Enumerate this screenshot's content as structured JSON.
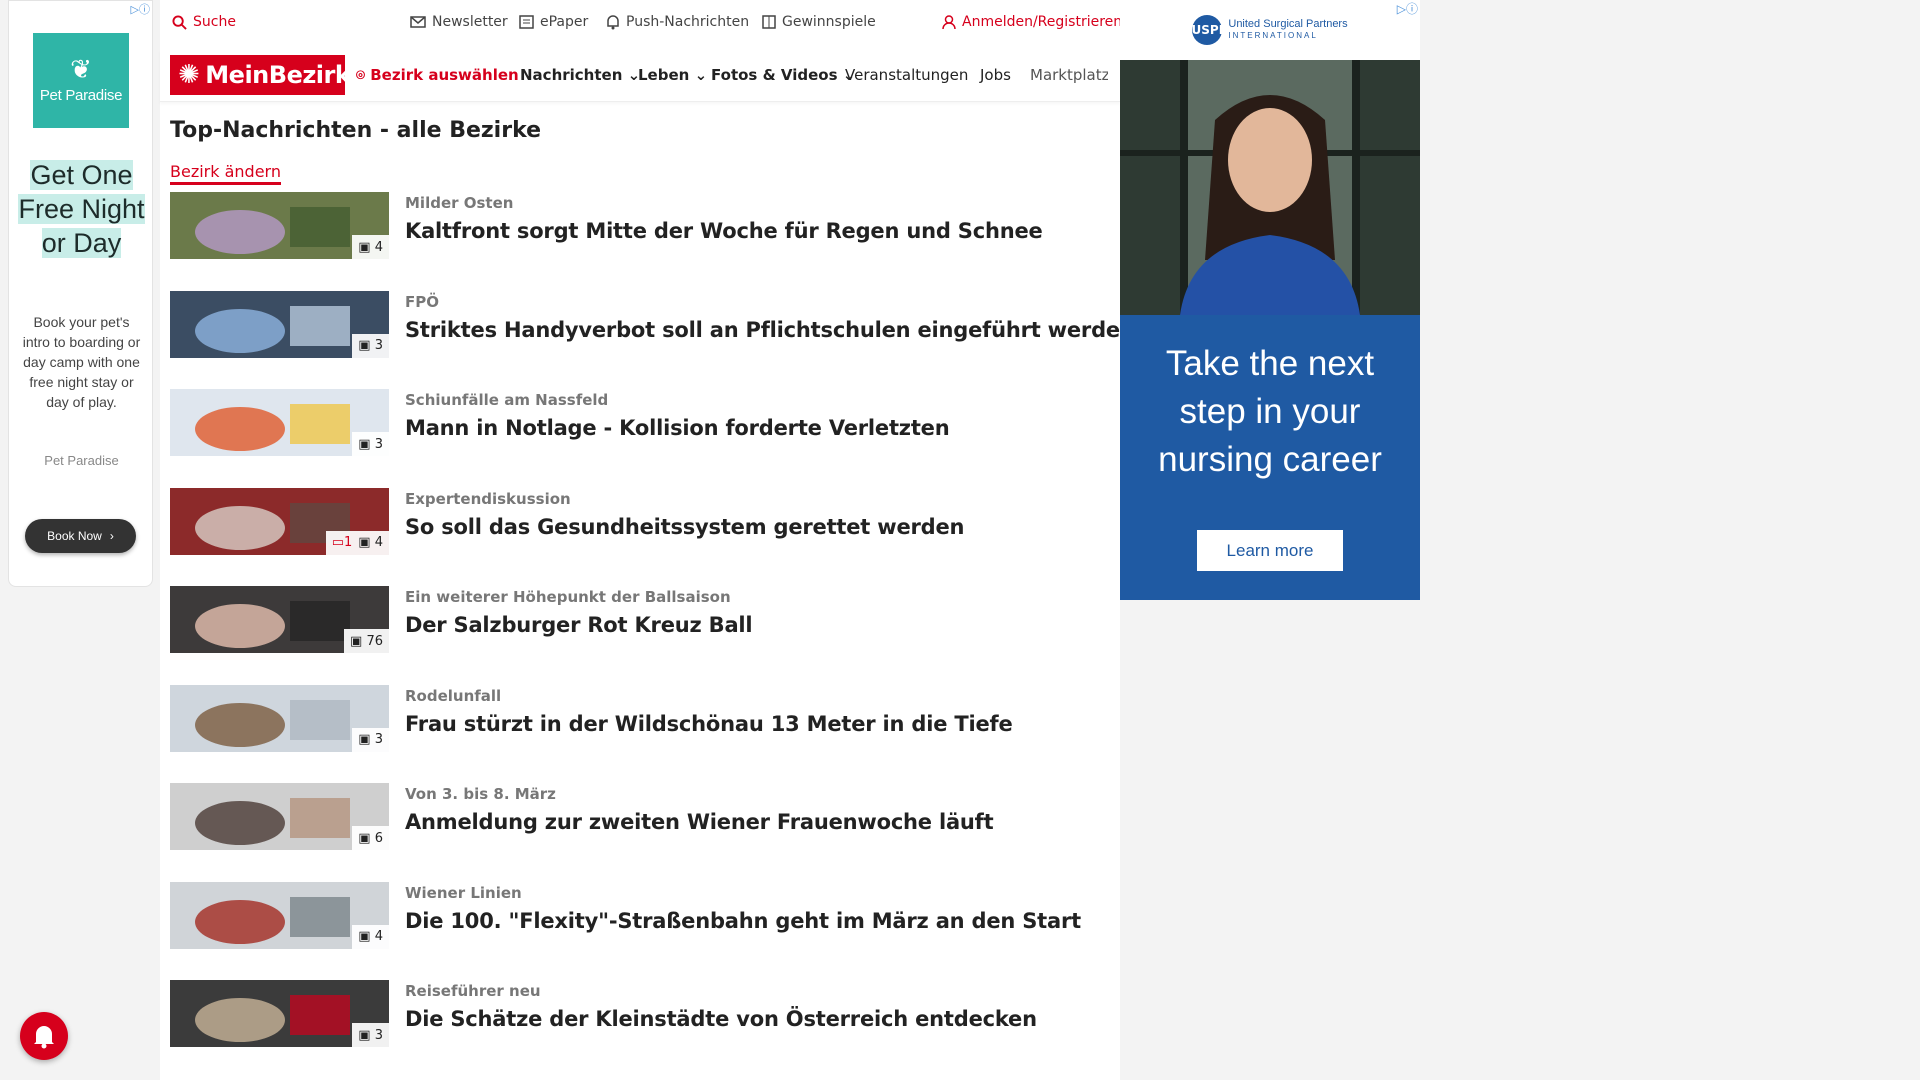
{
  "left_ad": {
    "brand": "Pet Paradise",
    "headline": "Get One Free Night or Day",
    "body": "Book your pet's intro to boarding or day camp with one free night stay or day of play.",
    "advertiser": "Pet Paradise",
    "cta": "Book Now"
  },
  "topbar": {
    "search": "Suche",
    "newsletter": "Newsletter",
    "epaper": "ePaper",
    "push": "Push-Nachrichten",
    "games": "Gewinnspiele",
    "login": "Anmelden/Registrieren"
  },
  "nav": {
    "logo": "MeinBezirk",
    "district": "Bezirk auswählen",
    "items": [
      "Nachrichten",
      "Leben",
      "Fotos & Videos",
      "Veranstaltungen",
      "Jobs",
      "Marktplatz"
    ]
  },
  "page": {
    "title": "Top-Nachrichten - alle Bezirke",
    "change_district": "Bezirk ändern"
  },
  "articles": [
    {
      "category": "Milder Osten",
      "title": "Kaltfront sorgt Mitte der Woche für Regen und Schnee",
      "images": "4",
      "comments": ""
    },
    {
      "category": "FPÖ",
      "title": "Striktes Handyverbot soll an Pflichtschulen eingeführt werden",
      "images": "3",
      "comments": ""
    },
    {
      "category": "Schiunfälle am Nassfeld",
      "title": "Mann in Notlage - Kollision forderte Verletzten",
      "images": "3",
      "comments": ""
    },
    {
      "category": "Expertendiskussion",
      "title": "So soll das Gesundheitssystem gerettet werden",
      "images": "4",
      "comments": "1"
    },
    {
      "category": "Ein weiterer Höhepunkt der Ballsaison",
      "title": "Der Salzburger Rot Kreuz Ball",
      "images": "76",
      "comments": ""
    },
    {
      "category": "Rodelunfall",
      "title": "Frau stürzt in der Wildschönau 13 Meter in die Tiefe",
      "images": "3",
      "comments": ""
    },
    {
      "category": "Von 3. bis 8. März",
      "title": "Anmeldung zur zweiten Wiener Frauenwoche läuft",
      "images": "6",
      "comments": ""
    },
    {
      "category": "Wiener Linien",
      "title": "Die 100. \"Flexity\"-Straßenbahn geht im März an den Start",
      "images": "4",
      "comments": ""
    },
    {
      "category": "Reiseführer neu",
      "title": "Die Schätze der Kleinstädte von Österreich entdecken",
      "images": "3",
      "comments": ""
    }
  ],
  "right_ad": {
    "brand_line1": "United Surgical Partners",
    "brand_line2": "INTERNATIONAL",
    "mark": "USPI",
    "tagline": "Take the next step in your nursing career",
    "cta": "Learn more"
  },
  "colors": {
    "brand_red": "#d6001c",
    "ad_teal": "#2fb5a7",
    "ad_blue": "#1f5aa3"
  }
}
